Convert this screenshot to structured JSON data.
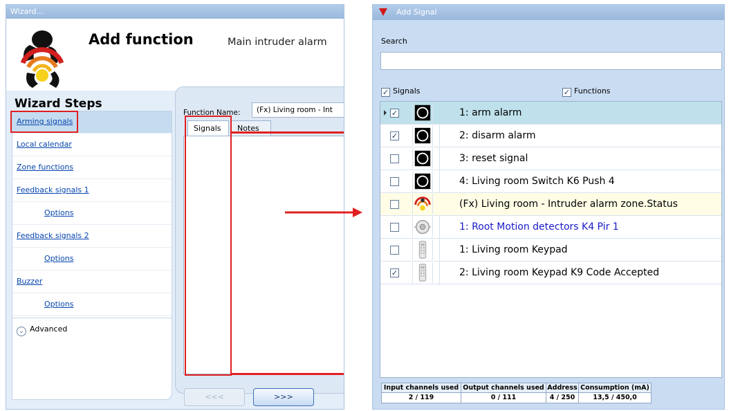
{
  "wizard": {
    "window_title": "Wizard...",
    "title": "Add function",
    "subtitle": "Main intruder alarm",
    "steps_heading": "Wizard Steps",
    "steps": [
      {
        "label": "Arming signals",
        "sub": false,
        "active": true
      },
      {
        "label": "Local calendar",
        "sub": false,
        "active": false
      },
      {
        "label": "Zone functions",
        "sub": false,
        "active": false
      },
      {
        "label": "Feedback signals 1",
        "sub": false,
        "active": false
      },
      {
        "label": "Options",
        "sub": true,
        "active": false
      },
      {
        "label": "Feedback signals 2",
        "sub": false,
        "active": false
      },
      {
        "label": "Options",
        "sub": true,
        "active": false
      },
      {
        "label": "Buzzer",
        "sub": false,
        "active": false
      },
      {
        "label": "Options",
        "sub": true,
        "active": false
      }
    ],
    "advanced_label": "Advanced",
    "function_name_label": "Function Name:",
    "function_name_value": "(Fx) Living room - Int",
    "tabs": [
      "Signals",
      "Notes"
    ],
    "prev_button": "<<<",
    "next_button": ">>>"
  },
  "add_signal": {
    "window_title": "Add Signal",
    "search_label": "Search",
    "search_value": "",
    "filter_signals_label": "Signals",
    "filter_signals_checked": true,
    "filter_functions_label": "Functions",
    "filter_functions_checked": true,
    "rows": [
      {
        "checked": true,
        "label": "1: arm alarm",
        "icon": "push-button-icon",
        "style": "selected",
        "color": ""
      },
      {
        "checked": true,
        "label": "2: disarm alarm",
        "icon": "push-button-icon",
        "style": "",
        "color": ""
      },
      {
        "checked": false,
        "label": "3: reset signal",
        "icon": "push-button-icon",
        "style": "",
        "color": ""
      },
      {
        "checked": false,
        "label": "4: Living room Switch K6 Push 4",
        "icon": "push-button-icon",
        "style": "",
        "color": ""
      },
      {
        "checked": false,
        "label": "(Fx) Living room - Intruder alarm zone.Status",
        "icon": "alarm-zone-icon",
        "style": "function",
        "color": ""
      },
      {
        "checked": false,
        "label": "1: Root Motion detectors K4 Pir 1",
        "icon": "motion-detector-icon",
        "style": "",
        "color": "#1818c8"
      },
      {
        "checked": false,
        "label": "1: Living room Keypad",
        "icon": "keypad-icon",
        "style": "",
        "color": ""
      },
      {
        "checked": true,
        "label": "2: Living room Keypad K9 Code Accepted",
        "icon": "keypad-icon",
        "style": "",
        "color": ""
      }
    ],
    "status": [
      {
        "label": "Input channels used",
        "value": "2 / 119"
      },
      {
        "label": "Output channels used",
        "value": "0 / 111"
      },
      {
        "label": "Address",
        "value": "4 / 250"
      },
      {
        "label": "Consumption (mA)",
        "value": "13,5 / 450,0"
      }
    ]
  },
  "colors": {
    "highlight": "#e02020",
    "selected_row": "#bfe1ec",
    "function_row": "#fffde6",
    "link": "#0645ad"
  }
}
